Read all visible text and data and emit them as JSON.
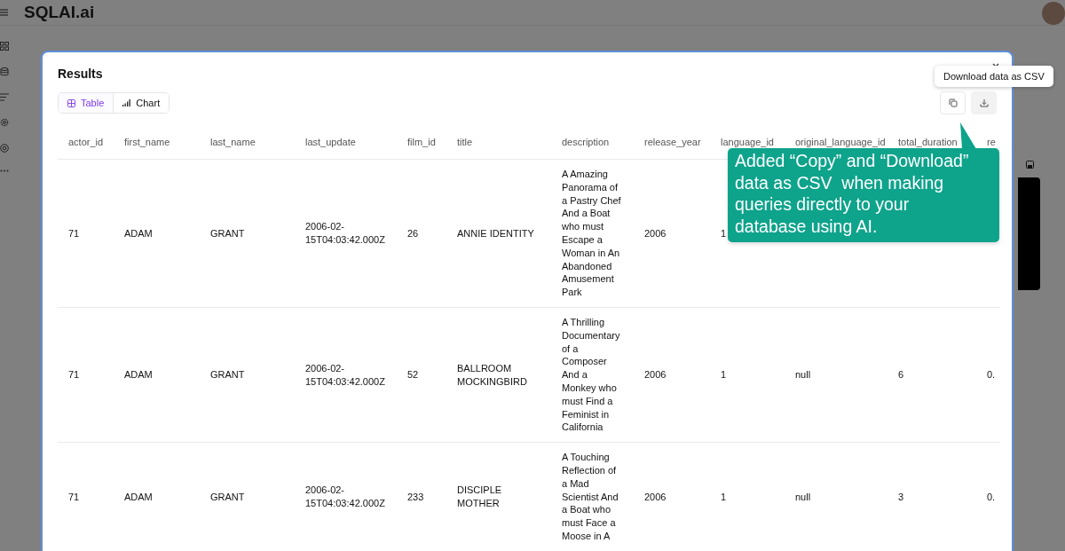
{
  "app": {
    "logo": "SQLAI.ai"
  },
  "modal": {
    "title": "Results",
    "tabs": [
      {
        "label": "Table",
        "selected": true
      },
      {
        "label": "Chart",
        "selected": false
      }
    ],
    "tooltip": "Download data as CSV",
    "table": {
      "columns": [
        "actor_id",
        "first_name",
        "last_name",
        "last_update",
        "film_id",
        "title",
        "description",
        "release_year",
        "language_id",
        "original_language_id",
        "total_duration",
        "re"
      ],
      "rows": [
        {
          "cells": [
            "71",
            "ADAM",
            "GRANT",
            "2006-02-15T04:03:42.000Z",
            "26",
            "ANNIE IDENTITY",
            "A Amazing Panorama of a Pastry Chef And a Boat who must Escape a Woman in An Abandoned Amusement Park",
            "2006",
            "1",
            null,
            null,
            null
          ]
        },
        {
          "cells": [
            "71",
            "ADAM",
            "GRANT",
            "2006-02-15T04:03:42.000Z",
            "52",
            "BALLROOM MOCKINGBIRD",
            "A Thrilling Documentary of a Composer And a Monkey who must Find a Feminist in California",
            "2006",
            "1",
            "null",
            "6",
            "0."
          ]
        },
        {
          "cells": [
            "71",
            "ADAM",
            "GRANT",
            "2006-02-15T04:03:42.000Z",
            "233",
            "DISCIPLE MOTHER",
            "A Touching Reflection of a Mad Scientist And a Boat who must Face a Moose in A",
            "2006",
            "1",
            "null",
            "3",
            "0."
          ]
        }
      ]
    }
  },
  "callout": {
    "text": "Added “Copy” and “Download” data as CSV  when making queries directly to your database using AI."
  }
}
